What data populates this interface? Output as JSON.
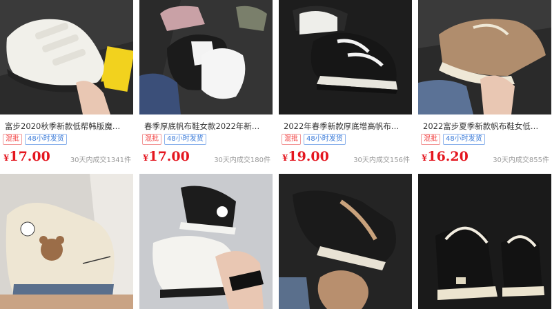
{
  "products": [
    {
      "title": "富步2020秋季新款低帮韩版魔…",
      "tags": [
        "混批",
        "48小时发货"
      ],
      "currency": "¥",
      "price": "17.00",
      "sold": "30天内成交1341件"
    },
    {
      "title": "春季厚底帆布鞋女款2022年新…",
      "tags": [
        "混批",
        "48小时发货"
      ],
      "currency": "¥",
      "price": "17.00",
      "sold": "30天内成交180件"
    },
    {
      "title": "2022年春季新款厚底增高帆布…",
      "tags": [
        "混批",
        "48小时发货"
      ],
      "currency": "¥",
      "price": "19.00",
      "sold": "30天内成交156件"
    },
    {
      "title": "2022富步夏季新款帆布鞋女低…",
      "tags": [
        "混批",
        "48小时发货"
      ],
      "currency": "¥",
      "price": "16.20",
      "sold": "30天内成交855件"
    }
  ]
}
